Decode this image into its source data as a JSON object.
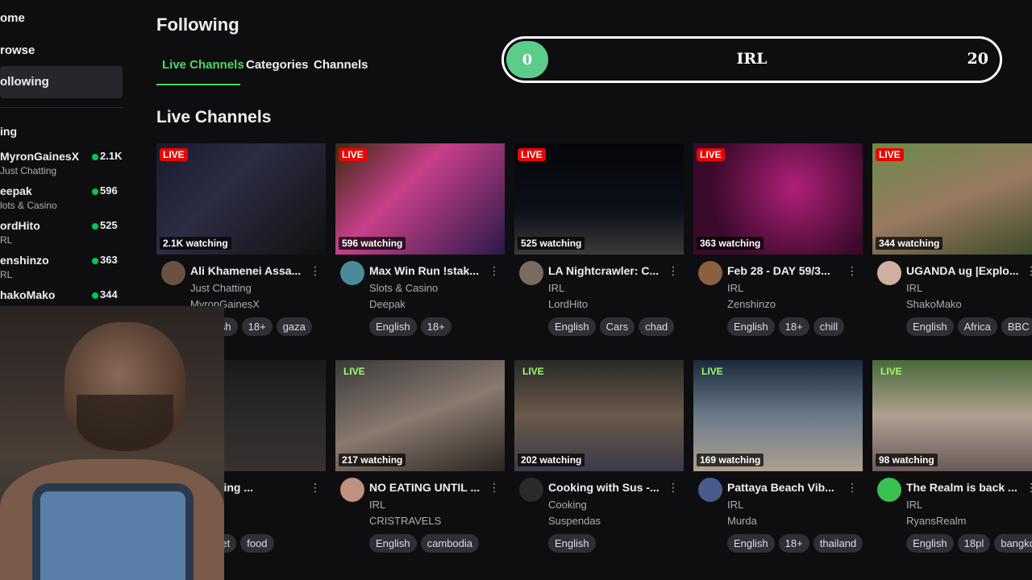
{
  "sidebar": {
    "nav": [
      {
        "label": "ome"
      },
      {
        "label": "rowse"
      },
      {
        "label": "ollowing"
      }
    ],
    "section_heading": "ing",
    "channels": [
      {
        "name": "MyronGainesX",
        "category": "Just Chatting",
        "viewers": "2.1K"
      },
      {
        "name": "eepak",
        "category": "lots & Casino",
        "viewers": "596"
      },
      {
        "name": "ordHito",
        "category": "RL",
        "viewers": "525"
      },
      {
        "name": "enshinzo",
        "category": "RL",
        "viewers": "363"
      },
      {
        "name": "hakoMako",
        "category": "",
        "viewers": "344"
      }
    ]
  },
  "header": {
    "title": "Following",
    "tabs": [
      {
        "label": "Live Channels"
      },
      {
        "label": "Categories"
      },
      {
        "label": "Channels"
      }
    ]
  },
  "progress": {
    "current": "0",
    "label": "IRL",
    "max": "20",
    "fill_fraction": 0,
    "color": "#5ccc8a"
  },
  "section_title": "Live Channels",
  "live_label": "LIVE",
  "cards": [
    {
      "watching": "2.1K watching",
      "title": "Ali Khamenei Assa...",
      "category": "Just Chatting",
      "streamer": "MyronGainesX",
      "tags": [
        "English",
        "18+",
        "gaza"
      ]
    },
    {
      "watching": "596 watching",
      "title": "Max Win Run !stak...",
      "category": "Slots & Casino",
      "streamer": "Deepak",
      "tags": [
        "English",
        "18+"
      ]
    },
    {
      "watching": "525 watching",
      "title": "LA Nightcrawler: C...",
      "category": "IRL",
      "streamer": "LordHito",
      "tags": [
        "English",
        "Cars",
        "chad"
      ]
    },
    {
      "watching": "363 watching",
      "title": "Feb 28 - DAY 59/3...",
      "category": "IRL",
      "streamer": "Zenshinzo",
      "tags": [
        "English",
        "18+",
        "chill"
      ]
    },
    {
      "watching": "344 watching",
      "title": "UGANDA ug |Explo...",
      "category": "IRL",
      "streamer": "ShakoMako",
      "tags": [
        "English",
        "Africa",
        "BBC"
      ]
    },
    {
      "watching": "",
      "title": "Watching ...",
      "category": "atting",
      "streamer": "e",
      "tags": [
        "B86bet",
        "food"
      ]
    },
    {
      "watching": "217 watching",
      "title": "NO EATING UNTIL ...",
      "category": "IRL",
      "streamer": "CRISTRAVELS",
      "tags": [
        "English",
        "cambodia"
      ]
    },
    {
      "watching": "202 watching",
      "title": "Cooking with Sus -...",
      "category": "Cooking",
      "streamer": "Suspendas",
      "tags": [
        "English"
      ]
    },
    {
      "watching": "169 watching",
      "title": "Pattaya Beach Vib...",
      "category": "IRL",
      "streamer": "Murda",
      "tags": [
        "English",
        "18+",
        "thailand"
      ]
    },
    {
      "watching": "98 watching",
      "title": "The Realm is back ...",
      "category": "IRL",
      "streamer": "RyansRealm",
      "tags": [
        "English",
        "18pl",
        "bangkok"
      ]
    }
  ]
}
